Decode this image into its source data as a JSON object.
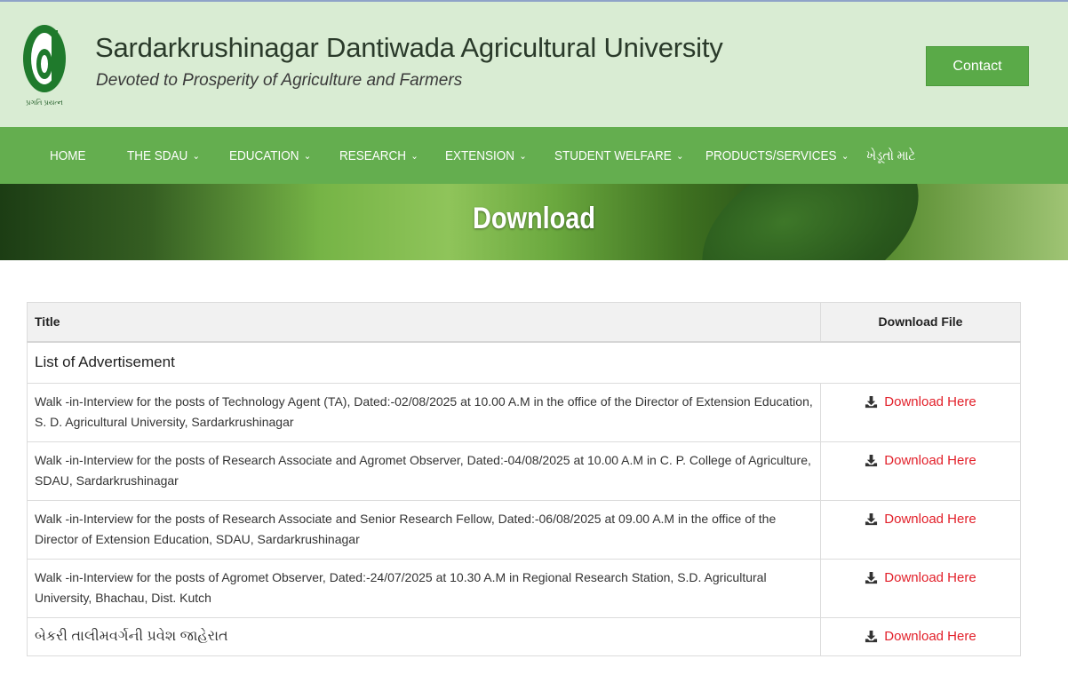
{
  "header": {
    "title": "Sardarkrushinagar Dantiwada Agricultural University",
    "tagline": "Devoted to Prosperity of Agriculture and Farmers",
    "logo_text": "પ્રગતિ પ્રયત્ન",
    "contact_label": "Contact"
  },
  "nav": {
    "items": [
      {
        "label": "HOME",
        "has_dropdown": false
      },
      {
        "label": "THE SDAU",
        "has_dropdown": true
      },
      {
        "label": "EDUCATION",
        "has_dropdown": true
      },
      {
        "label": "RESEARCH",
        "has_dropdown": true
      },
      {
        "label": "EXTENSION",
        "has_dropdown": true
      },
      {
        "label": "STUDENT WELFARE",
        "has_dropdown": true
      },
      {
        "label": "PRODUCTS/SERVICES",
        "has_dropdown": true
      },
      {
        "label": "ખેડૂતો માટે",
        "has_dropdown": false
      }
    ]
  },
  "banner": {
    "title": "Download"
  },
  "table": {
    "headers": {
      "title": "Title",
      "download": "Download File"
    },
    "group_label": "List of Advertisement",
    "rows": [
      {
        "title": "Walk -in-Interview for the posts of Technology Agent (TA), Dated:-02/08/2025 at 10.00 A.M in the office of the Director of Extension Education, S. D. Agricultural University, Sardarkrushinagar",
        "link_label": "Download Here"
      },
      {
        "title": "Walk -in-Interview for the posts of Research Associate and Agromet Observer, Dated:-04/08/2025 at 10.00 A.M in C. P. College of Agriculture, SDAU, Sardarkrushinagar",
        "link_label": "Download Here"
      },
      {
        "title": "Walk -in-Interview for the posts of Research Associate and Senior Research Fellow, Dated:-06/08/2025 at 09.00 A.M in the office of the Director of Extension Education, SDAU, Sardarkrushinagar",
        "link_label": "Download Here"
      },
      {
        "title": "Walk -in-Interview for the posts of Agromet Observer, Dated:-24/07/2025 at 10.30 A.M in Regional Research Station, S.D. Agricultural University, Bhachau, Dist. Kutch",
        "link_label": "Download Here"
      },
      {
        "title": "બેકરી તાલીમવર્ગની પ્રવેશ જાહેરાત",
        "link_label": "Download Here"
      }
    ]
  },
  "colors": {
    "header_bg": "#d9ecd3",
    "nav_bg": "#64ae4f",
    "contact_bg": "#5aaa48",
    "link": "#e2202a",
    "logo_green": "#1f7a2c"
  },
  "icons": {
    "download": "download-tray-icon",
    "dropdown": "chevron-down-icon"
  }
}
